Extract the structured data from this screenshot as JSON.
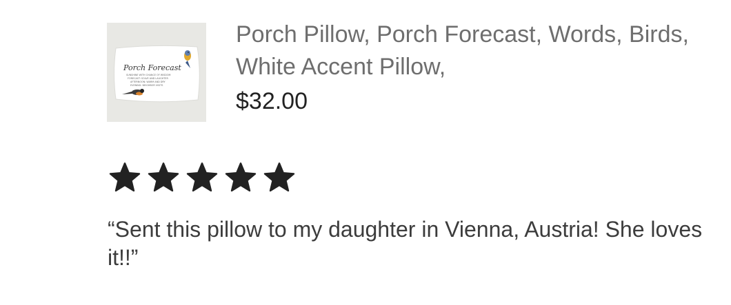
{
  "product": {
    "title": "Porch Pillow, Porch Forecast, Words, Birds, White Accent Pillow,",
    "price": "$32.00",
    "thumbnail": {
      "icon": "pillow-product-image",
      "pillow_heading": "Porch Forecast",
      "pillow_lines": [
        "SUNSHINE WITH CHANCE OF WISDOM",
        "FORECAST: SOLVE AND LAUGHTER",
        "AFTERNOON: WARM AND DRY",
        "EVENING: NEIGHBOR VISITS"
      ]
    }
  },
  "review": {
    "rating": 5,
    "rating_max": 5,
    "star_color": "#222222",
    "text": "“Sent this pillow to my daughter in Vienna, Austria! She loves it!!”"
  }
}
